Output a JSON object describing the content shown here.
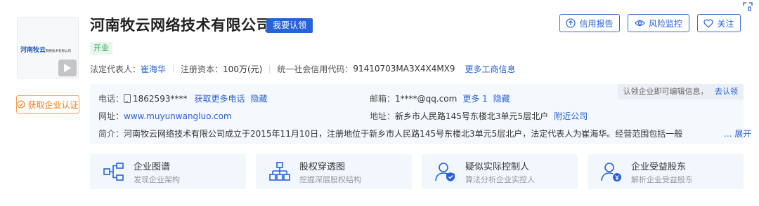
{
  "company": {
    "name": "河南牧云网络技术有限公司",
    "claim_tag": "我要认领",
    "status": "开业",
    "logo_text": "河南牧云",
    "logo_sub": "网络技术有限公司"
  },
  "actions": {
    "report": "信用报告",
    "risk": "风险监控",
    "follow": "关注",
    "auth": "获取企业认证"
  },
  "meta": {
    "legal_rep_label": "法定代表人：",
    "legal_rep": "崔海华",
    "capital_label": "注册资本：",
    "capital": "100万(元)",
    "credit_code_label": "统一社会信用代码：",
    "credit_code": "91410703MA3X4X4MX9",
    "more_info": "更多工商信息"
  },
  "contact": {
    "claim_note": "认领企业即可编辑信息，",
    "claim_link": "去认领",
    "phone_label": "电话：",
    "phone": "1862593****",
    "phone_more": "获取更多电话",
    "phone_hide": "隐藏",
    "email_label": "邮箱：",
    "email": "1****@qq.com",
    "email_more": "更多 1",
    "email_hide": "隐藏",
    "website_label": "网址：",
    "website": "www.muyunwangluo.com",
    "address_label": "地址：",
    "address": "新乡市人民路145号东楼北3单元5层北户",
    "address_link": "附近公司",
    "intro_label": "简介：",
    "intro": "河南牧云网络技术有限公司成立于2015年11月10日，注册地位于新乡市人民路145号东楼北3单元5层北户，法定代表人为崔海华。经营范围包括一般",
    "intro_more": "... 展开"
  },
  "features": [
    {
      "title": "企业图谱",
      "subtitle": "发现企业架构",
      "icon": "org-graph-icon"
    },
    {
      "title": "股权穿透图",
      "subtitle": "挖掘深层股权结构",
      "icon": "equity-tree-icon"
    },
    {
      "title": "疑似实际控制人",
      "subtitle": "算法分析企业实控人",
      "icon": "controller-person-icon"
    },
    {
      "title": "企业受益股东",
      "subtitle": "解析企业受益股东",
      "icon": "beneficiary-person-icon"
    }
  ],
  "colors": {
    "primary": "#2762d8",
    "auth_orange": "#f07a12",
    "status_green": "#2fa851",
    "panel_bg": "#f5f8fc",
    "feature_bg": "#f2f6fd"
  }
}
